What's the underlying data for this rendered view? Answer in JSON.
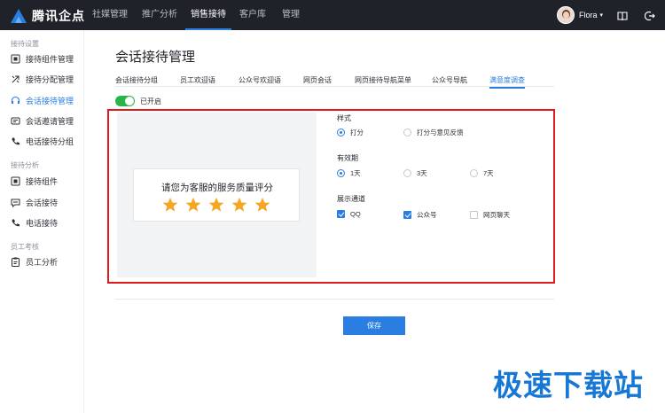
{
  "app": {
    "logo_text": "腾讯企点"
  },
  "nav": {
    "items": [
      {
        "label": "社媒管理"
      },
      {
        "label": "推广分析"
      },
      {
        "label": "销售接待"
      },
      {
        "label": "客户库"
      },
      {
        "label": "管理"
      }
    ],
    "active_index": 2
  },
  "user": {
    "name": "Flora",
    "caret": "▾"
  },
  "sidebar": {
    "groups": [
      {
        "title": "接待设置"
      },
      {
        "title": "接待分析"
      },
      {
        "title": "员工考核"
      }
    ],
    "items": [
      {
        "label": "接待组件管理",
        "icon": "widget-icon"
      },
      {
        "label": "接待分配管理",
        "icon": "distribute-icon"
      },
      {
        "label": "会话接待管理",
        "icon": "headset-icon"
      },
      {
        "label": "会话邀请管理",
        "icon": "invite-icon"
      },
      {
        "label": "电话接待分组",
        "icon": "phone-icon"
      },
      {
        "label": "接待组件",
        "icon": "widget-icon"
      },
      {
        "label": "会话接待",
        "icon": "chat-icon"
      },
      {
        "label": "电话接待",
        "icon": "phone-icon"
      },
      {
        "label": "员工分析",
        "icon": "clipboard-icon"
      }
    ],
    "active_index": 2
  },
  "main": {
    "title": "会话接待管理",
    "tabs": [
      {
        "label": "会话接待分组"
      },
      {
        "label": "员工欢迎语"
      },
      {
        "label": "公众号欢迎语"
      },
      {
        "label": "网页会话"
      },
      {
        "label": "网页接待导航菜单"
      },
      {
        "label": "公众号导航"
      },
      {
        "label": "满意度调查"
      }
    ],
    "active_tab_index": 6,
    "toggle": {
      "label": "已开启",
      "on": true
    },
    "preview": {
      "prompt": "请您为客服的服务质量评分",
      "stars": 5,
      "star_color": "#f5a623"
    },
    "style": {
      "title": "样式",
      "options": [
        {
          "label": "打分",
          "selected": true
        },
        {
          "label": "打分与意见反馈",
          "selected": false
        }
      ]
    },
    "validity": {
      "title": "有效期",
      "options": [
        {
          "label": "1天",
          "selected": true
        },
        {
          "label": "3天",
          "selected": false
        },
        {
          "label": "7天",
          "selected": false
        }
      ]
    },
    "channels": {
      "title": "展示通道",
      "options": [
        {
          "label": "QQ",
          "checked": true
        },
        {
          "label": "公众号",
          "checked": true
        },
        {
          "label": "网页聊天",
          "checked": false
        }
      ]
    },
    "save_label": "保存"
  },
  "colors": {
    "accent": "#2a7de1",
    "highlight_border": "#e01919",
    "toggle_on": "#28b446",
    "topbar": "#1f2329"
  },
  "watermark": "极速下载站"
}
